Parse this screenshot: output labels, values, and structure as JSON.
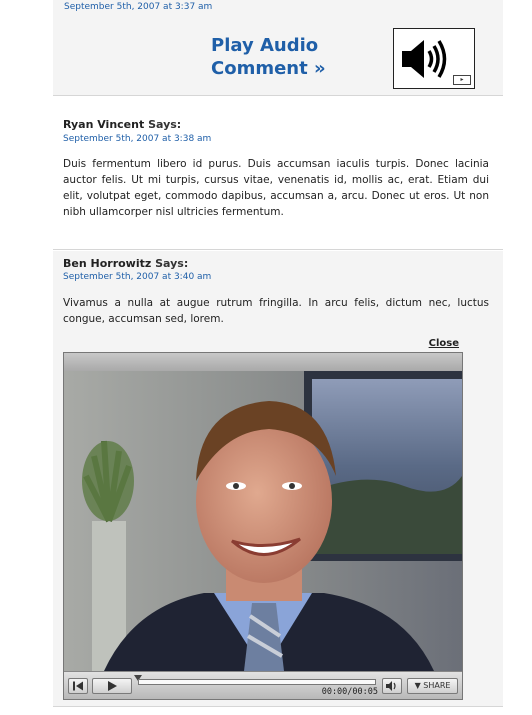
{
  "comments": [
    {
      "date": "September 5th, 2007 at 3:37 am",
      "audio_link": "Play Audio Comment »",
      "speaker_icon": "speaker-icon"
    },
    {
      "author": "Ryan Vincent",
      "says": "Says:",
      "date": "September 5th, 2007 at 3:38 am",
      "body": "Duis fermentum libero id purus. Duis accumsan iaculis turpis. Donec lacinia auctor felis. Ut mi turpis, cursus vitae, venenatis id, mollis ac, erat. Etiam dui elit, volutpat eget, commodo dapibus, accumsan a, arcu. Donec ut eros. Ut non nibh ullamcorper nisl ultricies fermentum."
    },
    {
      "author": "Ben Horrowitz",
      "says": "Says:",
      "date": "September 5th, 2007 at 3:40 am",
      "body": "Vivamus a nulla at augue rutrum fringilla. In arcu felis, dictum nec, luctus congue, accumsan sed, lorem.",
      "close_label": "Close"
    }
  ],
  "player": {
    "timecode": "00:00/00:05",
    "share_label": "▼ SHARE",
    "progress_fraction": 0.0,
    "icons": {
      "start": "skip-to-start-icon",
      "play": "play-icon",
      "volume": "volume-icon"
    }
  },
  "colors": {
    "link": "#1f5fa8",
    "panel_bg": "#f4f4f4"
  }
}
